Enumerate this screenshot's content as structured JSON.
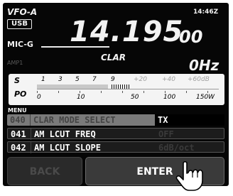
{
  "header": {
    "vfo_label": "VFO-A",
    "mode": "USB",
    "mic_label": "MIC-G",
    "clock": "14:46Z",
    "frequency_main": "14.195",
    "frequency_fine": "00",
    "amp_label": "AMP1",
    "clar_label": "CLAR",
    "clar_value": "0Hz"
  },
  "meter": {
    "s_label": "S",
    "po_label": "PO",
    "s_scale": [
      "1",
      "3",
      "5",
      "7",
      "9"
    ],
    "s_scale_over": [
      "+20",
      "+40",
      "+60dB"
    ],
    "po_scale": [
      "0",
      "10",
      "50",
      "100",
      "150W"
    ]
  },
  "menu": {
    "title": "MENU",
    "items": [
      {
        "number": "040",
        "name": "CLAR MODE SELECT",
        "value": "TX",
        "selected": true
      },
      {
        "number": "041",
        "name": "AM LCUT FREQ",
        "value": "OFF",
        "selected": false
      },
      {
        "number": "042",
        "name": "AM LCUT SLOPE",
        "value": "6dB/oct",
        "selected": false
      }
    ]
  },
  "buttons": {
    "back_label": "BACK",
    "enter_label": "ENTER"
  },
  "colors": {
    "lcd_bg": "#060606",
    "text": "#f2f2f2",
    "row_selected": "#7a7a7a",
    "row_normal": "#1c1c1c",
    "button_face": "#3a3a3a"
  },
  "icons": {
    "pointer": "hand-pointer-icon"
  }
}
